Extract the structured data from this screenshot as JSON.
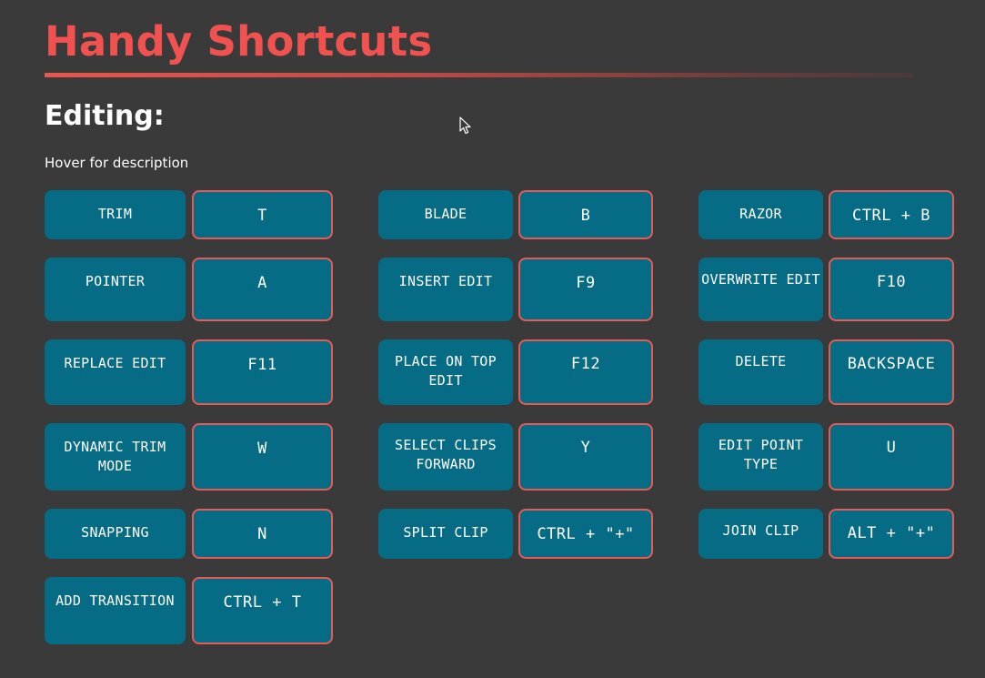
{
  "title": "Handy Shortcuts",
  "section": "Editing:",
  "hint": "Hover for description",
  "colors": {
    "background": "#3a3a3a",
    "title": "#f0524f",
    "button": "#066b84",
    "key_border": "#e65b55"
  },
  "shortcuts": [
    {
      "action": "TRIM",
      "key": "T"
    },
    {
      "action": "BLADE",
      "key": "B"
    },
    {
      "action": "RAZOR",
      "key": "CTRL + B"
    },
    {
      "action": "POINTER",
      "key": "A"
    },
    {
      "action": "INSERT EDIT",
      "key": "F9"
    },
    {
      "action": "OVERWRITE EDIT",
      "key": "F10"
    },
    {
      "action": "REPLACE EDIT",
      "key": "F11"
    },
    {
      "action": "PLACE ON TOP EDIT",
      "key": "F12"
    },
    {
      "action": "DELETE",
      "key": "BACKSPACE"
    },
    {
      "action": "DYNAMIC TRIM MODE",
      "key": "W"
    },
    {
      "action": "SELECT CLIPS FORWARD",
      "key": "Y"
    },
    {
      "action": "EDIT POINT TYPE",
      "key": "U"
    },
    {
      "action": "SNAPPING",
      "key": "N"
    },
    {
      "action": "SPLIT CLIP",
      "key": "CTRL + \"+\""
    },
    {
      "action": "JOIN CLIP",
      "key": "ALT + \"+\""
    },
    {
      "action": "ADD TRANSITION",
      "key": "CTRL + T"
    }
  ]
}
